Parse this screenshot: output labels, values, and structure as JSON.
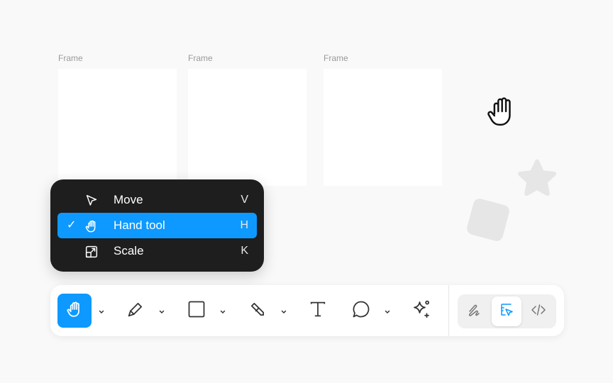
{
  "canvas": {
    "frames": [
      {
        "label": "Frame"
      },
      {
        "label": "Frame"
      },
      {
        "label": "Frame"
      }
    ]
  },
  "tool_menu": {
    "items": [
      {
        "label": "Move",
        "shortcut": "V",
        "icon": "move-icon",
        "selected": false
      },
      {
        "label": "Hand tool",
        "shortcut": "H",
        "icon": "hand-icon",
        "selected": true,
        "check": "✓"
      },
      {
        "label": "Scale",
        "shortcut": "K",
        "icon": "scale-icon",
        "selected": false
      }
    ]
  },
  "toolbar": {
    "tools": [
      {
        "name": "hand-tool",
        "icon": "hand-icon",
        "active": true,
        "has_dropdown": true
      },
      {
        "name": "pen-tool",
        "icon": "pen-icon",
        "active": false,
        "has_dropdown": true
      },
      {
        "name": "rectangle-tool",
        "icon": "rectangle-icon",
        "active": false,
        "has_dropdown": true
      },
      {
        "name": "pencil-tool",
        "icon": "pencil-icon",
        "active": false,
        "has_dropdown": true
      },
      {
        "name": "text-tool",
        "icon": "text-icon",
        "active": false,
        "has_dropdown": false
      },
      {
        "name": "comment-tool",
        "icon": "comment-icon",
        "active": false,
        "has_dropdown": true
      },
      {
        "name": "ai-tool",
        "icon": "sparkle-icon",
        "active": false,
        "has_dropdown": false
      }
    ],
    "modes": [
      {
        "name": "draw-mode",
        "icon": "squiggle-icon",
        "active": false
      },
      {
        "name": "design-mode",
        "icon": "design-icon",
        "active": true
      },
      {
        "name": "dev-mode",
        "icon": "code-icon",
        "active": false
      }
    ]
  },
  "colors": {
    "accent": "#0d99ff",
    "menu_bg": "#1e1e1e",
    "canvas_bg": "#f9f9f9",
    "frame_bg": "#ffffff"
  }
}
